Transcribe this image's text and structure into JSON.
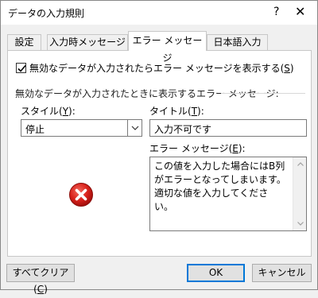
{
  "window": {
    "title": "データの入力規則",
    "help_glyph": "?",
    "close_glyph": "✕"
  },
  "tabs": [
    {
      "label": "設定"
    },
    {
      "label": "入力時メッセージ"
    },
    {
      "label": "エラー メッセージ"
    },
    {
      "label": "日本語入力"
    }
  ],
  "active_tab": "エラー メッセージ",
  "show_error_checkbox": {
    "checked": true,
    "label_prefix": "無効なデータが入力されたらエラー メッセージを表示する(",
    "mnemonic": "S",
    "label_suffix": ")"
  },
  "section_label": "無効なデータが入力されたときに表示するエラー メッセージ:",
  "style": {
    "label_prefix": "スタイル(",
    "mnemonic": "Y",
    "label_suffix": "):",
    "value": "停止",
    "icon": "error-stop-icon"
  },
  "title_field": {
    "label_prefix": "タイトル(",
    "mnemonic": "T",
    "label_suffix": "):",
    "value": "入力不可です"
  },
  "error_message_field": {
    "label_prefix": "エラー メッセージ(",
    "mnemonic": "E",
    "label_suffix": "):",
    "value": "この値を入力した場合にはB列がエラーとなってしまいます。適切な値を入力してください。"
  },
  "buttons": {
    "clear_prefix": "すべてクリア(",
    "clear_mnemonic": "C",
    "clear_suffix": ")",
    "ok": "OK",
    "cancel": "キャンセル"
  },
  "colors": {
    "error_icon": "#d9211b",
    "default_button_border": "#0078d7",
    "panel_bg": "#ffffff",
    "dialog_bg": "#f0f0f0"
  }
}
